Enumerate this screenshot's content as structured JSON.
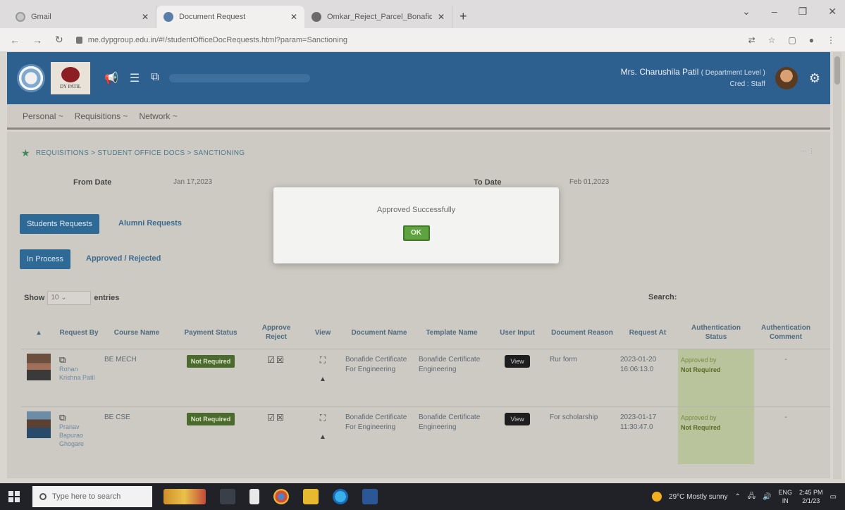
{
  "browser": {
    "tabs": [
      {
        "title": "Gmail",
        "icon": "gmail-icon",
        "active": false
      },
      {
        "title": "Document Request",
        "icon": "document-icon",
        "active": true
      },
      {
        "title": "Omkar_Reject_Parcel_Bonafide",
        "icon": "chrome-icon",
        "active": false
      }
    ],
    "url": "me.dypgroup.edu.in/#!/studentOfficeDocRequests.html?param=Sanctioning"
  },
  "header": {
    "college_logo_text": "DY PATIL",
    "user_name": "Mrs. Charushila Patil",
    "user_role": "( Department Level )",
    "user_role_2": "Cred : Staff"
  },
  "menu": [
    "Personal ~",
    "Requisitions ~",
    "Network ~"
  ],
  "breadcrumb": "REQUISITIONS > STUDENT OFFICE DOCS > SANCTIONING",
  "filters": {
    "from_label": "From Date",
    "from_value": "Jan 17,2023",
    "to_label": "To Date",
    "to_value": "Feb 01,2023"
  },
  "tabs_primary": {
    "active": "Students Requests",
    "other": "Alumni Requests"
  },
  "tabs_secondary": {
    "active": "In Process",
    "other": "Approved / Rejected"
  },
  "table_controls": {
    "show_label": "Show",
    "show_value": "10",
    "entries_label": "entries",
    "search_label": "Search:"
  },
  "table": {
    "headers": [
      "Request By",
      "Course Name",
      "Payment Status",
      "Approve Reject",
      "View",
      "Document Name",
      "Template Name",
      "User Input",
      "Document Reason",
      "Request At",
      "Authentication Status",
      "Authentication Comment"
    ],
    "rows": [
      {
        "name": "Rohan Krishna Patil",
        "course": "BE MECH",
        "payment": "Not Required",
        "document": "Bonafide Certificate For Engineering",
        "template": "Bonafide Certificate Engineering",
        "user_input": "View",
        "reason": "Rur form",
        "request_at": "2023-01-20 16:06:13.0",
        "auth_status_1": "Approved by",
        "auth_status_2": "Not Required",
        "auth_comment": "-"
      },
      {
        "name": "Pranav Bapurao Ghogare",
        "course": "BE CSE",
        "payment": "Not Required",
        "document": "Bonafide Certificate For Engineering",
        "template": "Bonafide Certificate Engineering",
        "user_input": "View",
        "reason": "For scholarship",
        "request_at": "2023-01-17 11:30:47.0",
        "auth_status_1": "Approved by",
        "auth_status_2": "Not Required",
        "auth_comment": "-"
      }
    ]
  },
  "modal": {
    "message": "Approved Successfully",
    "ok_label": "OK"
  },
  "taskbar": {
    "search_placeholder": "Type here to search",
    "weather": "29°C  Mostly sunny",
    "lang_1": "ENG",
    "lang_2": "IN",
    "time": "2:45 PM",
    "date": "2/1/23"
  },
  "colors": {
    "header_blue": "#2d5f8f",
    "ok_green": "#5fa340",
    "badge_green": "#4b6a2e"
  }
}
